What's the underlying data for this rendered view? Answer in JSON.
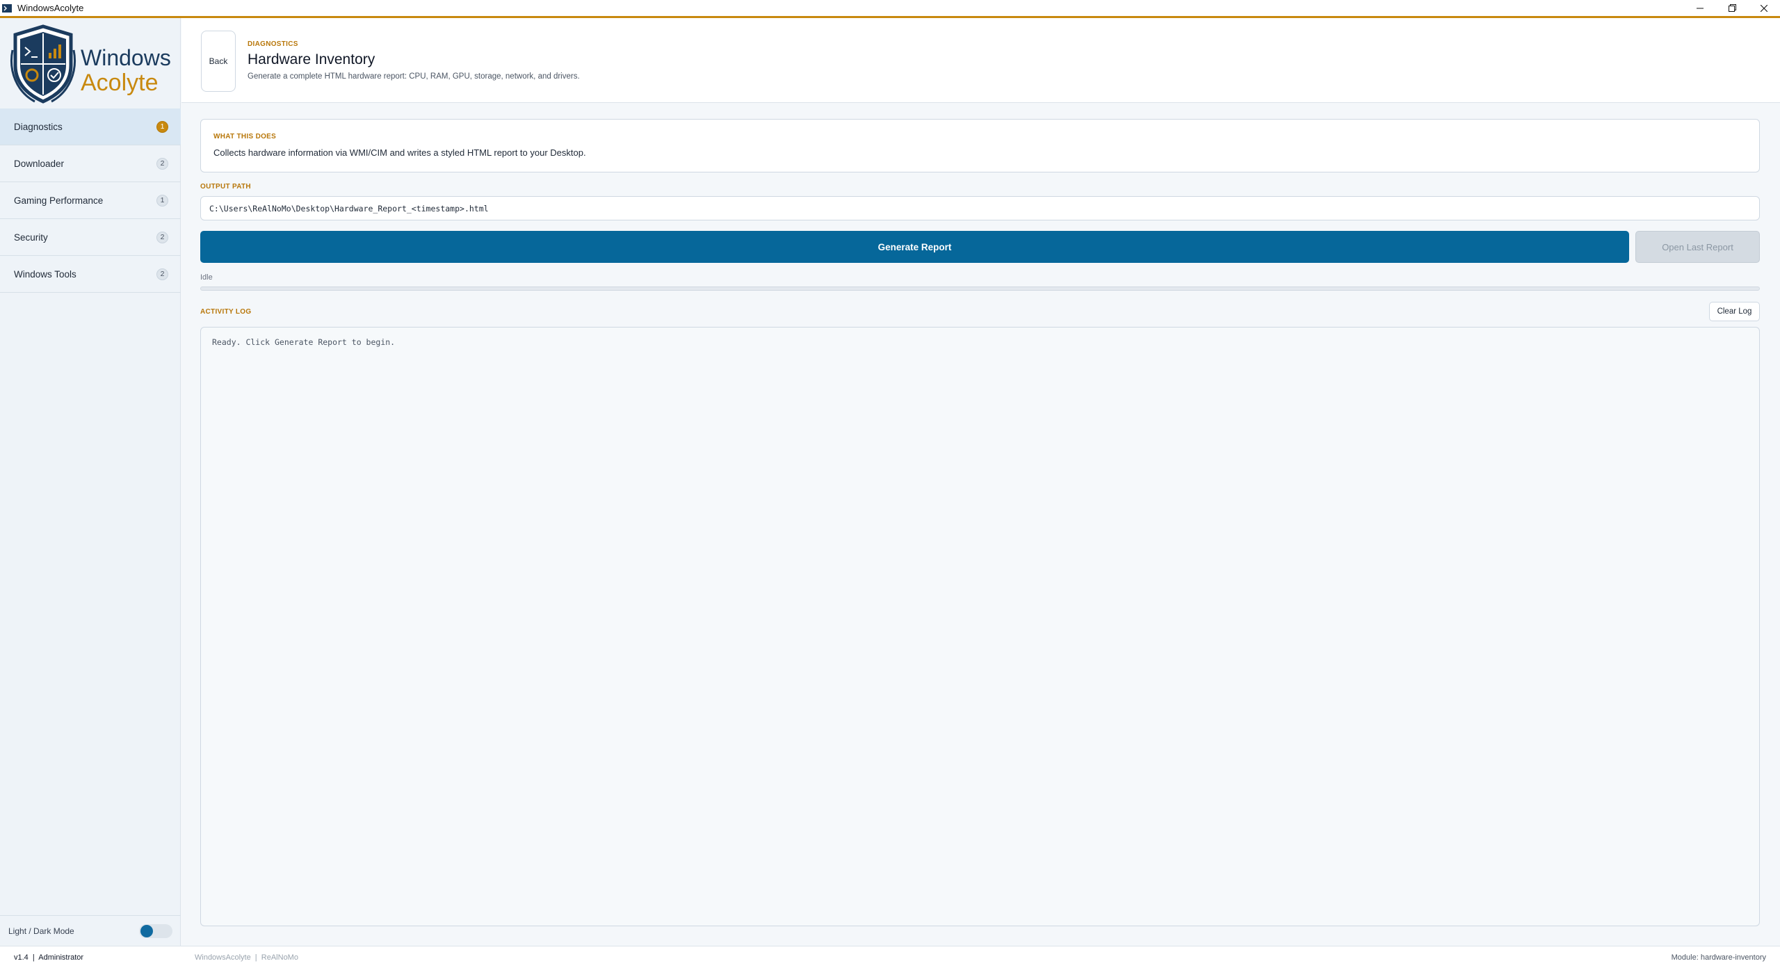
{
  "window": {
    "title": "WindowsAcolyte"
  },
  "logo": {
    "line1": "Windows",
    "line2": "Acolyte"
  },
  "sidebar": {
    "items": [
      {
        "label": "Diagnostics",
        "count": "1",
        "active": true
      },
      {
        "label": "Downloader",
        "count": "2"
      },
      {
        "label": "Gaming Performance",
        "count": "1"
      },
      {
        "label": "Security",
        "count": "2"
      },
      {
        "label": "Windows Tools",
        "count": "2"
      }
    ],
    "theme_label": "Light / Dark Mode"
  },
  "header": {
    "back_label": "Back",
    "breadcrumb": "DIAGNOSTICS",
    "title": "Hardware Inventory",
    "subtitle": "Generate a complete HTML hardware report: CPU, RAM, GPU, storage, network, and drivers."
  },
  "info": {
    "caption": "WHAT THIS DOES",
    "text": "Collects hardware information via WMI/CIM and writes a styled HTML report to your Desktop."
  },
  "output": {
    "label": "OUTPUT PATH",
    "value": "C:\\Users\\ReAlNoMo\\Desktop\\Hardware_Report_<timestamp>.html"
  },
  "actions": {
    "generate_label": "Generate Report",
    "open_label": "Open Last Report"
  },
  "status": {
    "text": "Idle",
    "progress": 0
  },
  "log": {
    "label": "ACTIVITY LOG",
    "clear_label": "Clear Log",
    "content": "Ready. Click Generate Report to begin."
  },
  "statusbar": {
    "left": "v1.4  |  Administrator",
    "middle": "WindowsAcolyte  |  ReAlNoMo",
    "right": "Module: hardware-inventory"
  },
  "colors": {
    "accent": "#c8890f",
    "primary": "#06679a",
    "sidebar_bg": "#eef3f8"
  }
}
